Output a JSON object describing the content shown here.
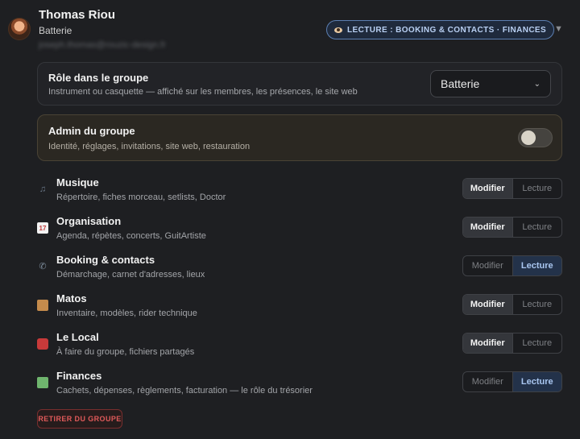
{
  "member": {
    "name": "Thomas Riou",
    "role": "Batterie",
    "email": "joseph.thomas@rouzic-design.fr",
    "access_badge": "LECTURE : BOOKING & CONTACTS · FINANCES",
    "collapse": "▼"
  },
  "role_card": {
    "title": "Rôle dans le groupe",
    "subtitle": "Instrument ou casquette — affiché sur les membres, les présences, le site web",
    "selected": "Batterie",
    "chevron": "⌄"
  },
  "admin_card": {
    "title": "Admin du groupe",
    "subtitle": "Identité, réglages, invitations, site web, restauration",
    "enabled": false
  },
  "permission_labels": {
    "edit": "Modifier",
    "read": "Lecture"
  },
  "permissions": [
    {
      "title": "Musique",
      "desc": "Répertoire, fiches morceau, setlists, Doctor",
      "icon": "music-note-icon",
      "glyph": "♫",
      "level": "edit"
    },
    {
      "title": "Organisation",
      "desc": "Agenda, répètes, concerts, GuitArtiste",
      "icon": "calendar-icon",
      "glyph": "17",
      "level": "edit"
    },
    {
      "title": "Booking & contacts",
      "desc": "Démarchage, carnet d'adresses, lieux",
      "icon": "phone-icon",
      "glyph": "✆",
      "level": "read"
    },
    {
      "title": "Matos",
      "desc": "Inventaire, modèles, rider technique",
      "icon": "package-icon",
      "glyph": "",
      "level": "edit"
    },
    {
      "title": "Le Local",
      "desc": "À faire du groupe, fichiers partagés",
      "icon": "toolbox-icon",
      "glyph": "",
      "level": "edit"
    },
    {
      "title": "Finances",
      "desc": "Cachets, dépenses, règlements, facturation — le rôle du trésorier",
      "icon": "money-icon",
      "glyph": "",
      "level": "read"
    }
  ],
  "leave_button": "RETIRER DU GROUPE"
}
